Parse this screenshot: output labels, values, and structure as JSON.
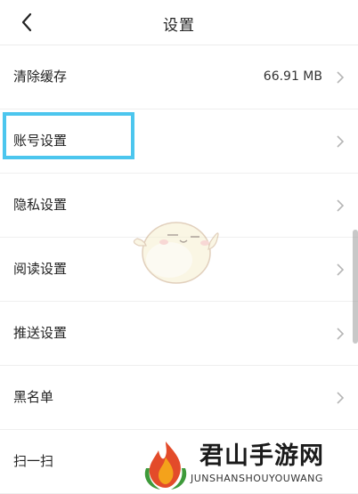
{
  "header": {
    "title": "设置",
    "back_icon": "chevron-left-icon"
  },
  "settings": [
    {
      "label": "清除缓存",
      "value": "66.91 MB"
    },
    {
      "label": "账号设置"
    },
    {
      "label": "隐私设置"
    },
    {
      "label": "阅读设置"
    },
    {
      "label": "推送设置"
    },
    {
      "label": "黑名单"
    },
    {
      "label": "扫一扫"
    }
  ],
  "highlight": {
    "color": "#4cc6ee",
    "target": "账号设置"
  },
  "watermark": {
    "name": "君山手游网",
    "subtitle": "JUNSHANSHOUYOUWANG"
  },
  "colors": {
    "background": "#ffffff",
    "divider": "#efefef",
    "chevron": "#b5b5b5"
  }
}
